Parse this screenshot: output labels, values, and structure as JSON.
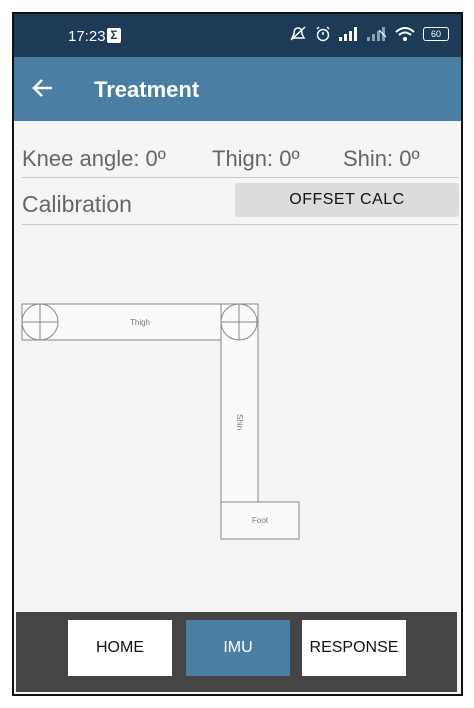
{
  "status_bar": {
    "time": "17:23",
    "battery": "60"
  },
  "app_bar": {
    "title": "Treatment"
  },
  "angles": {
    "knee": "Knee angle: 0º",
    "thigh": "Thign: 0º",
    "shin": "Shin: 0º"
  },
  "calibration": {
    "label": "Calibration",
    "button": "OFFSET CALC"
  },
  "diagram": {
    "thigh_label": "Thigh",
    "shin_label": "Shin",
    "foot_label": "Foot"
  },
  "bottom_nav": {
    "home": "HOME",
    "imu": "IMU",
    "response": "RESPONSE"
  },
  "colors": {
    "status_bar": "#1d3a57",
    "app_bar": "#4a7fa3",
    "active_tab": "#4a7fa3",
    "nav_background": "#444444"
  }
}
